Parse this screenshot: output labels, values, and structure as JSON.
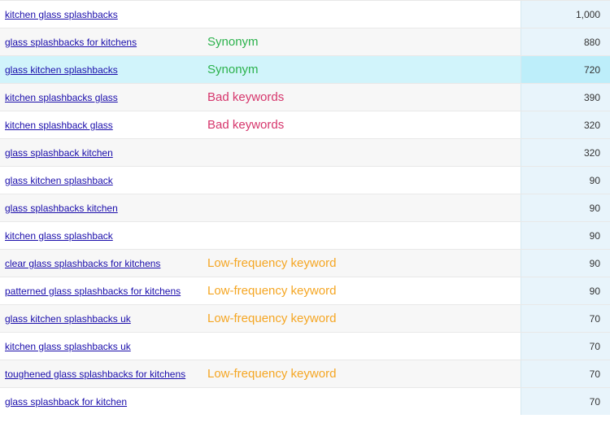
{
  "annotation_styles": {
    "synonym": "annot-synonym",
    "bad": "annot-bad",
    "lowfreq": "annot-lowfreq"
  },
  "rows": [
    {
      "keyword": "kitchen glass splashbacks",
      "annotation": "",
      "annot_type": "",
      "volume": "1,000",
      "highlighted": false
    },
    {
      "keyword": "glass splashbacks for kitchens",
      "annotation": "Synonym",
      "annot_type": "synonym",
      "volume": "880",
      "highlighted": false
    },
    {
      "keyword": "glass kitchen splashbacks",
      "annotation": "Synonym",
      "annot_type": "synonym",
      "volume": "720",
      "highlighted": true
    },
    {
      "keyword": "kitchen splashbacks glass",
      "annotation": "Bad keywords",
      "annot_type": "bad",
      "volume": "390",
      "highlighted": false
    },
    {
      "keyword": "kitchen splashback glass",
      "annotation": "Bad keywords",
      "annot_type": "bad",
      "volume": "320",
      "highlighted": false
    },
    {
      "keyword": "glass splashback kitchen",
      "annotation": "",
      "annot_type": "",
      "volume": "320",
      "highlighted": false
    },
    {
      "keyword": "glass kitchen splashback",
      "annotation": "",
      "annot_type": "",
      "volume": "90",
      "highlighted": false
    },
    {
      "keyword": "glass splashbacks kitchen",
      "annotation": "",
      "annot_type": "",
      "volume": "90",
      "highlighted": false
    },
    {
      "keyword": "kitchen glass splashback",
      "annotation": "",
      "annot_type": "",
      "volume": "90",
      "highlighted": false
    },
    {
      "keyword": "clear glass splashbacks for kitchens",
      "annotation": "Low-frequency keyword",
      "annot_type": "lowfreq",
      "volume": "90",
      "highlighted": false
    },
    {
      "keyword": "patterned glass splashbacks for kitchens",
      "annotation": "Low-frequency keyword",
      "annot_type": "lowfreq",
      "volume": "90",
      "highlighted": false
    },
    {
      "keyword": "glass kitchen splashbacks uk",
      "annotation": "Low-frequency keyword",
      "annot_type": "lowfreq",
      "volume": "70",
      "highlighted": false
    },
    {
      "keyword": "kitchen glass splashbacks uk",
      "annotation": "",
      "annot_type": "",
      "volume": "70",
      "highlighted": false
    },
    {
      "keyword": "toughened glass splashbacks for kitchens",
      "annotation": "Low-frequency keyword",
      "annot_type": "lowfreq",
      "volume": "70",
      "highlighted": false
    },
    {
      "keyword": "glass splashback for kitchen",
      "annotation": "",
      "annot_type": "",
      "volume": "70",
      "highlighted": false
    }
  ]
}
